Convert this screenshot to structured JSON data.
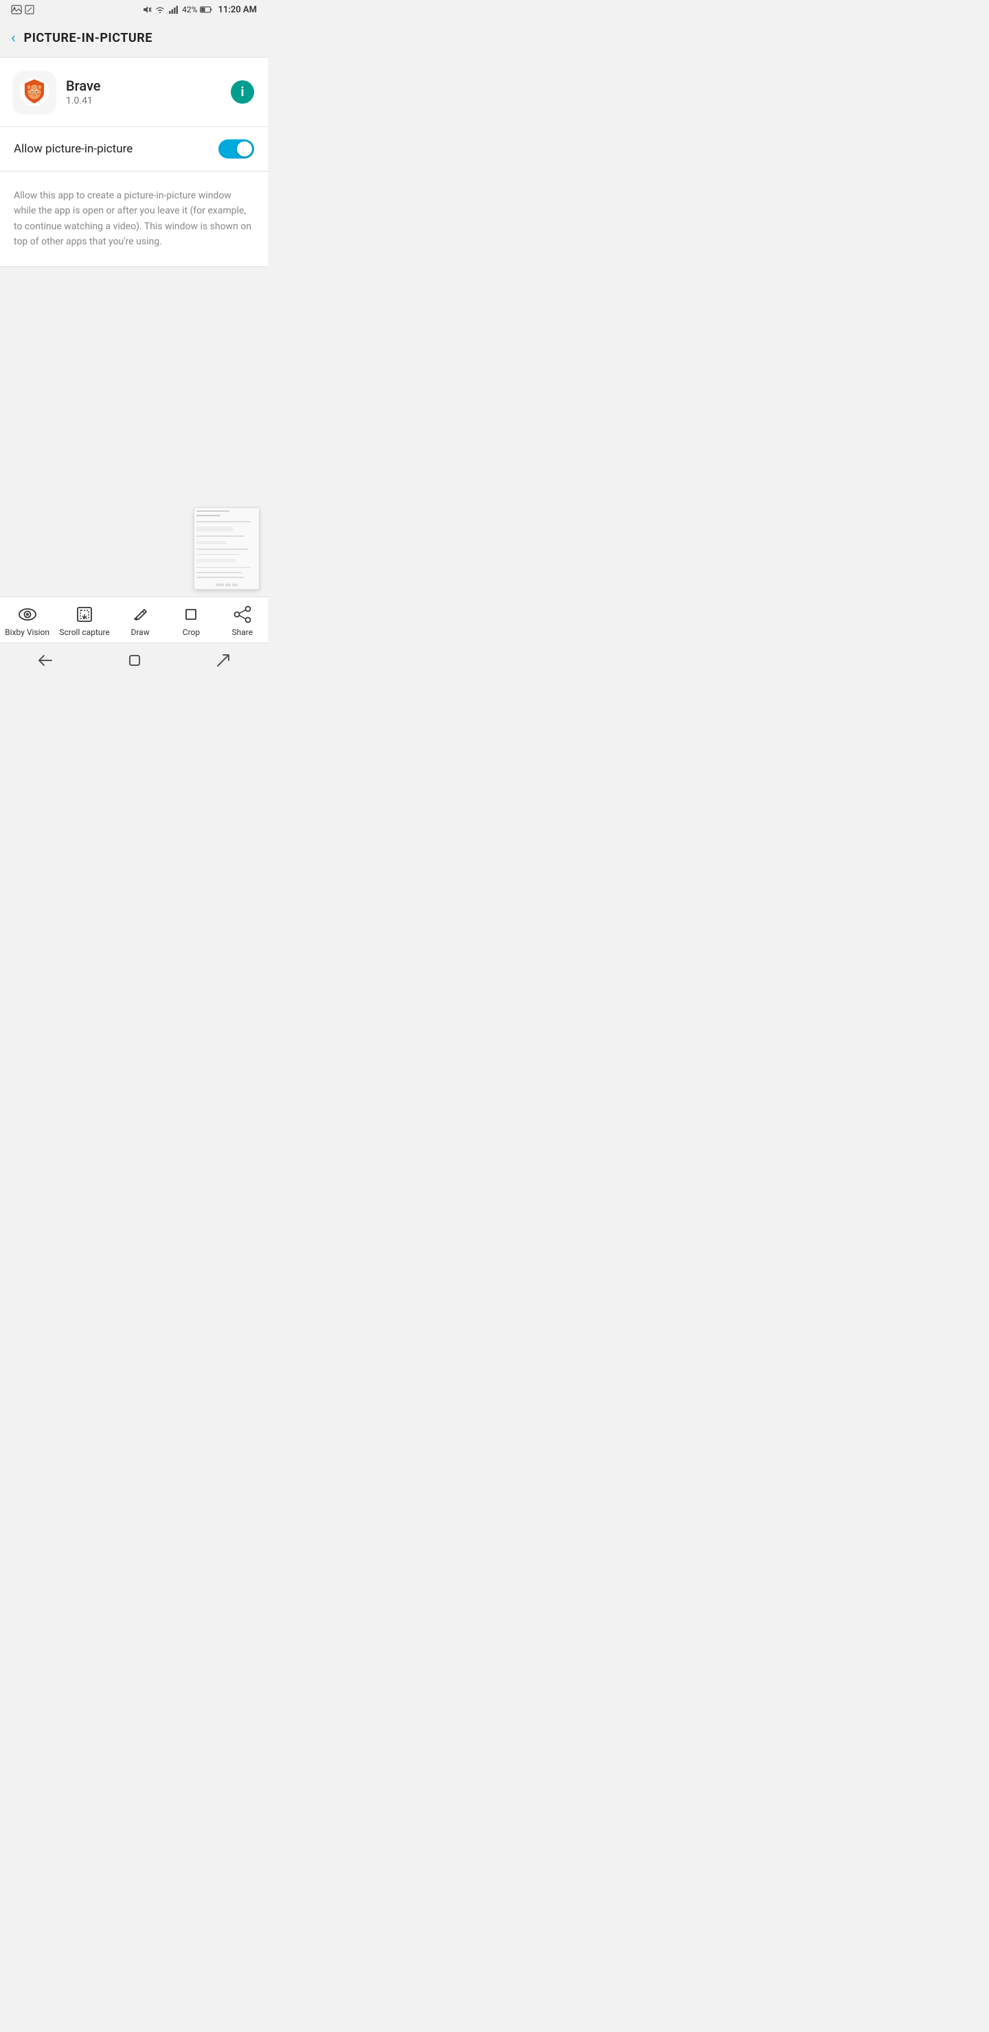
{
  "status_bar": {
    "time": "11:20 AM",
    "battery": "42%",
    "signal": "●●●●",
    "wifi": "WiFi"
  },
  "header": {
    "back_label": "‹",
    "title": "PICTURE-IN-PICTURE"
  },
  "app": {
    "name": "Brave",
    "version": "1.0.41",
    "info_label": "i"
  },
  "settings": {
    "toggle_label": "Allow picture-in-picture",
    "toggle_on": true
  },
  "description": {
    "text": "Allow this app to create a picture-in-picture window while the app is open or after you leave it (for example, to continue watching a video). This window is shown on top of other apps that you're using."
  },
  "toolbar": {
    "items": [
      {
        "id": "bixby-vision",
        "label": "Bixby Vision",
        "icon": "eye"
      },
      {
        "id": "scroll-capture",
        "label": "Scroll capture",
        "icon": "scroll"
      },
      {
        "id": "draw",
        "label": "Draw",
        "icon": "draw"
      },
      {
        "id": "crop",
        "label": "Crop",
        "icon": "crop"
      },
      {
        "id": "share",
        "label": "Share",
        "icon": "share"
      }
    ]
  },
  "nav_bar": {
    "back_label": "←",
    "recent_label": "☐",
    "home_label": "⌐"
  }
}
